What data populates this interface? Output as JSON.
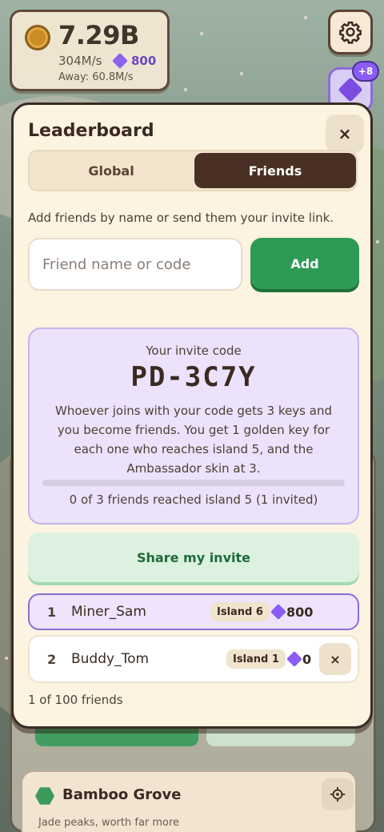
{
  "hud": {
    "coins": "7.29B",
    "rate": "304M/s",
    "gems": "800",
    "away": "Away: 60.8M/s",
    "gem_bonus_badge": "+8"
  },
  "icons": {
    "settings": "gear-icon",
    "shop": "gem-icon",
    "close": "close-icon",
    "locate": "crosshair-icon"
  },
  "colors": {
    "accent_green": "#2f9a55",
    "accent_purple": "#8b5cf6",
    "tab_active": "#4a3024",
    "modal_bg": "#fdf3e1"
  },
  "modal": {
    "title": "Leaderboard",
    "close_label": "×",
    "tabs": [
      {
        "label": "Global",
        "active": false
      },
      {
        "label": "Friends",
        "active": true
      }
    ],
    "hint": "Add friends by name or send them your invite link.",
    "input_placeholder": "Friend name or code",
    "add_label": "Add",
    "invite": {
      "label": "Your invite code",
      "code": "PD-3C7Y",
      "description": "Whoever joins with your code gets 3 keys and you become friends. You get 1 golden key for each one who reaches island 5, and the Ambassador skin at 3.",
      "progress_fraction": 0,
      "progress_text": "0 of 3 friends reached island 5 (1 invited)"
    },
    "share_label": "Share my invite",
    "friends": [
      {
        "rank": "1",
        "name": "Miner_Sam",
        "island": "Island 6",
        "gems": "800"
      },
      {
        "rank": "2",
        "name": "Buddy_Tom",
        "island": "Island 1",
        "gems": "0",
        "remove_label": "×"
      }
    ],
    "friend_count": "1 of 100 friends"
  },
  "background": {
    "island_name": "Bamboo Grove",
    "island_sub": "Jade peaks, worth far more"
  }
}
